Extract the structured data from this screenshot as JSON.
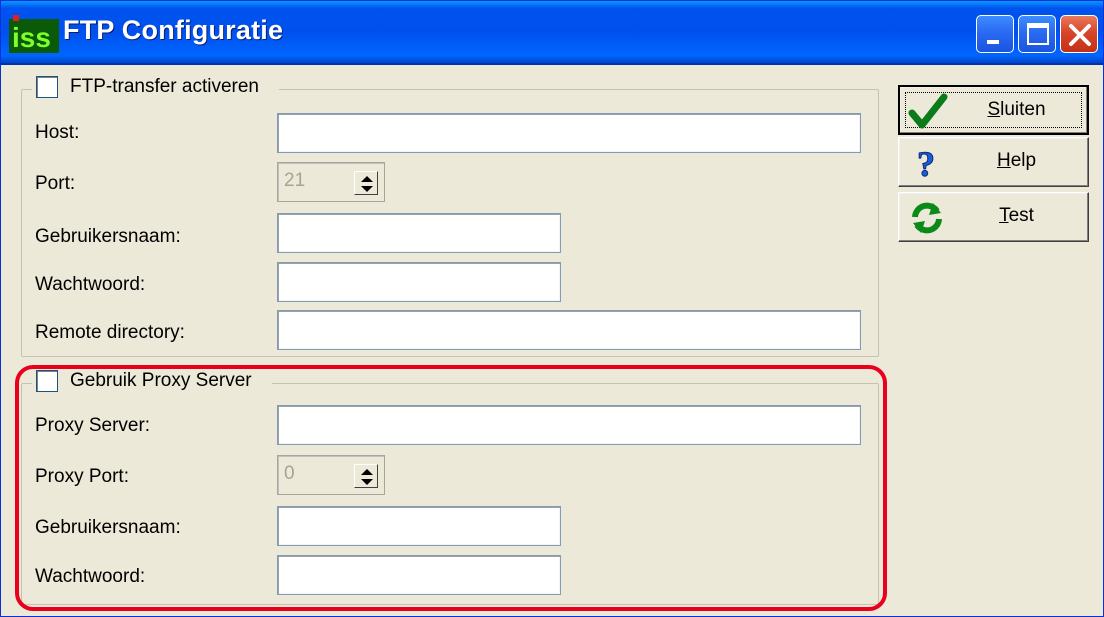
{
  "window": {
    "title": "FTP Configuratie",
    "icon": "iss-app-icon"
  },
  "ftp": {
    "enable_label": "FTP-transfer activeren",
    "enabled": false,
    "host_label": "Host:",
    "host_value": "",
    "port_label": "Port:",
    "port_value": "21",
    "username_label": "Gebruikersnaam:",
    "username_value": "",
    "password_label": "Wachtwoord:",
    "password_value": "",
    "remote_dir_label": "Remote directory:",
    "remote_dir_value": ""
  },
  "proxy": {
    "enable_label": "Gebruik Proxy Server",
    "enabled": false,
    "server_label": "Proxy Server:",
    "server_value": "",
    "port_label": "Proxy Port:",
    "port_value": "0",
    "username_label": "Gebruikersnaam:",
    "username_value": "",
    "password_label": "Wachtwoord:",
    "password_value": ""
  },
  "buttons": {
    "close_label_accel": "S",
    "close_label_rest": "luiten",
    "help_label_accel": "H",
    "help_label_rest": "elp",
    "test_label_accel": "T",
    "test_label_rest": "est"
  },
  "colors": {
    "highlight": "#e8001c",
    "titlebar": "#0053ee",
    "face": "#ece9d8"
  }
}
